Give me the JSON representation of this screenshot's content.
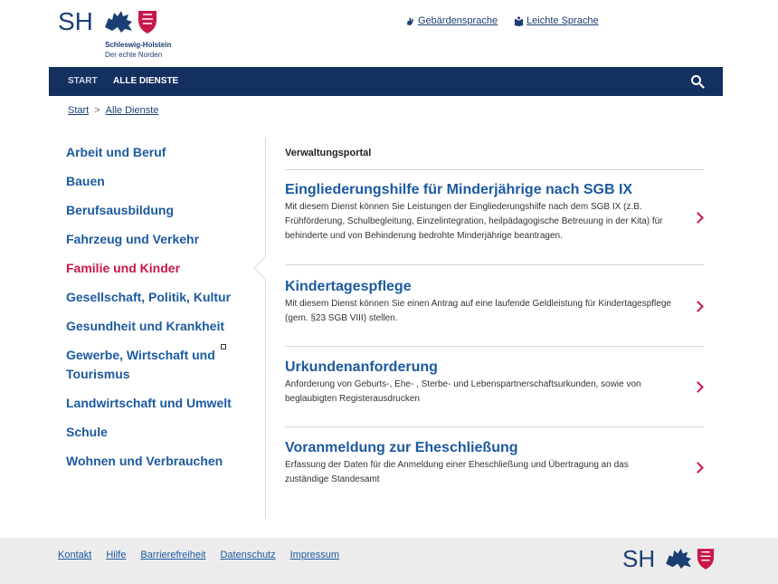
{
  "header": {
    "logo_letters": "SH",
    "logo_name": "Schleswig-Holstein",
    "logo_sub": "Der echte Norden",
    "links": [
      {
        "label": "Gebärdensprache",
        "icon": "sign-language-icon"
      },
      {
        "label": "Leichte Sprache",
        "icon": "easy-language-icon"
      }
    ]
  },
  "nav": {
    "items": [
      {
        "label": "START",
        "active": false
      },
      {
        "label": "ALLE DIENSTE",
        "active": true
      }
    ],
    "search_icon": "search-icon"
  },
  "breadcrumb": {
    "items": [
      "Start",
      "Alle Dienste"
    ],
    "separator": ">"
  },
  "sidebar": {
    "items": [
      {
        "label": "Arbeit und Beruf"
      },
      {
        "label": "Bauen"
      },
      {
        "label": "Berufsausbildung"
      },
      {
        "label": "Fahrzeug und Verkehr"
      },
      {
        "label": "Familie und Kinder",
        "active": true
      },
      {
        "label": "Gesellschaft, Politik, Kultur"
      },
      {
        "label": "Gesundheit und Krankheit"
      },
      {
        "label": "Gewerbe, Wirtschaft und Tourismus"
      },
      {
        "label": "Landwirtschaft und Umwelt"
      },
      {
        "label": "Schule"
      },
      {
        "label": "Wohnen und Verbrauchen"
      }
    ]
  },
  "main": {
    "section_title": "Verwaltungsportal",
    "services": [
      {
        "title": "Eingliederungshilfe für Minderjährige nach SGB IX",
        "description": "Mit diesem Dienst können Sie Leistungen der Eingliederungshilfe nach dem SGB IX (z.B. Frühförderung, Schulbegleitung, Einzelintegration, heilpädagogische Betreuung in der Kita) für behinderte und von Behinderung bedrohte Minderjährige beantragen."
      },
      {
        "title": "Kindertagespflege",
        "description": "Mit diesem Dienst können Sie einen Antrag auf eine laufende Geldleistung für Kindertagespflege (gem. §23 SGB VIII) stellen."
      },
      {
        "title": "Urkundenanforderung",
        "description": "Anforderung von Geburts-, Ehe- , Sterbe- und Lebenspartnerschaftsurkunden, sowie von beglaubigten Registerausdrucken"
      },
      {
        "title": "Voranmeldung zur Eheschließung",
        "description": "Erfassung der Daten für die Anmeldung einer Eheschließung und Übertragung an das zuständige Standesamt"
      }
    ]
  },
  "footer": {
    "links": [
      "Kontakt",
      "Hilfe",
      "Barrierefreiheit",
      "Datenschutz",
      "Impressum"
    ],
    "logo_letters": "SH"
  },
  "colors": {
    "brand_blue": "#14305f",
    "link_blue": "#1c5aa0",
    "accent_red": "#c8174a"
  }
}
